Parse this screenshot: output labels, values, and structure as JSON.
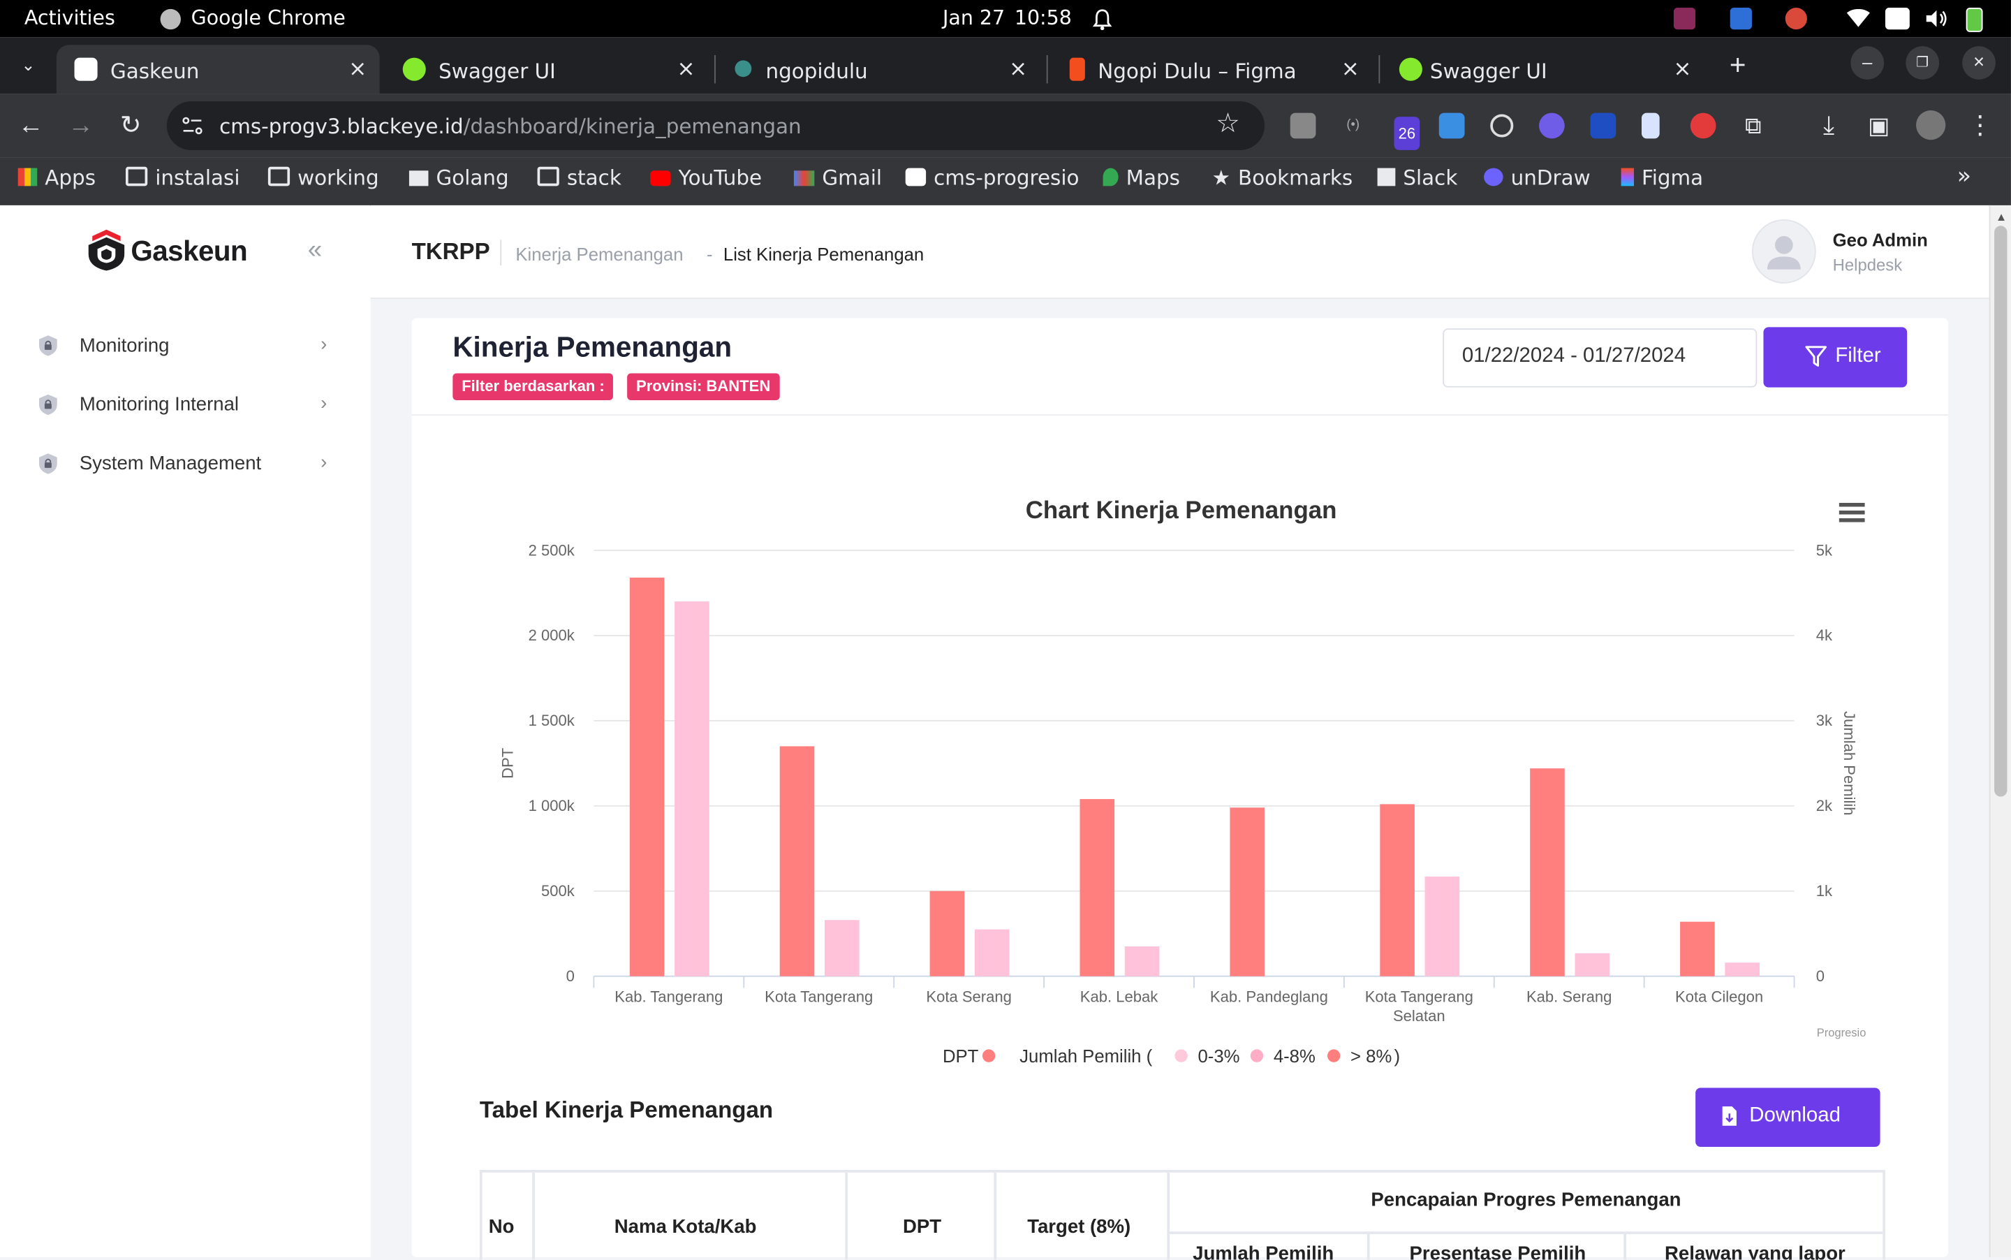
{
  "os": {
    "activities": "Activities",
    "app_name": "Google Chrome",
    "date": "Jan 27",
    "time": "10:58"
  },
  "browser": {
    "tabs": [
      {
        "title": "Gaskeun",
        "active": true
      },
      {
        "title": "Swagger UI",
        "active": false
      },
      {
        "title": "ngopidulu",
        "active": false
      },
      {
        "title": "Ngopi Dulu – Figma",
        "active": false
      },
      {
        "title": "Swagger UI",
        "active": false
      }
    ],
    "url_host": "cms-progv3.blackeye.id",
    "url_path": "/dashboard/kinerja_pemenangan",
    "ext_badge": "26",
    "bookmarks": [
      "Apps",
      "instalasi",
      "working",
      "Golang",
      "stack",
      "YouTube",
      "Gmail",
      "cms-progresio",
      "Maps",
      "Bookmarks",
      "Slack",
      "unDraw",
      "Figma"
    ]
  },
  "sidebar": {
    "brand": "Gaskeun",
    "items": [
      {
        "label": "Monitoring"
      },
      {
        "label": "Monitoring Internal"
      },
      {
        "label": "System Management"
      }
    ]
  },
  "header": {
    "title": "TKRPP",
    "breadcrumb_parent": "Kinerja Pemenangan",
    "breadcrumb_sep": "-",
    "breadcrumb_current": "List Kinerja Pemenangan",
    "user_name": "Geo Admin",
    "user_role": "Helpdesk"
  },
  "page": {
    "title": "Kinerja Pemenangan",
    "filter_label": "Filter berdasarkan :",
    "filter_value": "Provinsi: BANTEN",
    "date_range": "01/22/2024 - 01/27/2024",
    "filter_button": "Filter",
    "legend_dpt": "DPT",
    "legend_jumlah": "Jumlah Pemilih (",
    "legend_r1": "0-3%",
    "legend_r2": "4-8%",
    "legend_r3": "> 8%",
    "legend_close": ")",
    "credit": "Progresio",
    "table_title": "Tabel Kinerja Pemenangan",
    "download_button": "Download",
    "table_headers": {
      "no": "No",
      "nama": "Nama Kota/Kab",
      "dpt": "DPT",
      "target": "Target (8%)",
      "group": "Pencapaian Progres Pemenangan",
      "sub1": "Jumlah Pemilih",
      "sub2": "Presentase Pemilih",
      "sub3": "Relawan yang lapor"
    }
  },
  "colors": {
    "accent": "#6d3bea",
    "badge": "#e8376a",
    "dpt_bar": "#ff7f7f",
    "pemilih_bar": "#ffc2d9"
  },
  "chart_data": {
    "type": "bar",
    "title": "Chart Kinerja Pemenangan",
    "categories": [
      "Kab. Tangerang",
      "Kota Tangerang",
      "Kota Serang",
      "Kab. Lebak",
      "Kab. Pandeglang",
      "Kota Tangerang Selatan",
      "Kab. Serang",
      "Kota Cilegon"
    ],
    "category_lines": [
      [
        "Kab. Tangerang"
      ],
      [
        "Kota Tangerang"
      ],
      [
        "Kota Serang"
      ],
      [
        "Kab. Lebak"
      ],
      [
        "Kab. Pandeglang"
      ],
      [
        "Kota Tangerang",
        "Selatan"
      ],
      [
        "Kab. Serang"
      ],
      [
        "Kota Cilegon"
      ]
    ],
    "series": [
      {
        "name": "DPT",
        "axis": "left",
        "values": [
          2340000,
          1350000,
          500000,
          1040000,
          990000,
          1010000,
          1220000,
          320000
        ]
      },
      {
        "name": "Jumlah Pemilih",
        "axis": "right",
        "values": [
          4400,
          660,
          550,
          350,
          0,
          1170,
          270,
          160
        ]
      }
    ],
    "ylabel": "DPT",
    "ylabel_right": "Jumlah Pemilih",
    "ylim": [
      0,
      2500000
    ],
    "ylim_right": [
      0,
      5000
    ],
    "yticks": [
      "0",
      "500k",
      "1 000k",
      "1 500k",
      "2 000k",
      "2 500k"
    ],
    "yticks_right": [
      "0",
      "1k",
      "2k",
      "3k",
      "4k",
      "5k"
    ],
    "grid": true,
    "legend": "bottom"
  }
}
